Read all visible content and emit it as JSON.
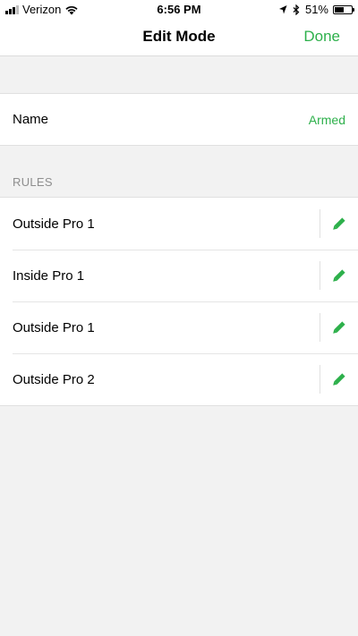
{
  "status_bar": {
    "carrier": "Verizon",
    "time": "6:56 PM",
    "battery": "51%"
  },
  "nav": {
    "title": "Edit Mode",
    "done_label": "Done"
  },
  "mode": {
    "name_label": "Name",
    "name_value": "Armed"
  },
  "rules": {
    "header": "RULES",
    "items": [
      {
        "label": "Outside Pro 1"
      },
      {
        "label": "Inside Pro 1"
      },
      {
        "label": "Outside Pro 1"
      },
      {
        "label": "Outside Pro 2"
      }
    ]
  },
  "colors": {
    "accent": "#2db04b",
    "background": "#f2f2f2",
    "header_text": "#8e8e8e"
  },
  "icons": {
    "edit": "pencil-icon"
  }
}
